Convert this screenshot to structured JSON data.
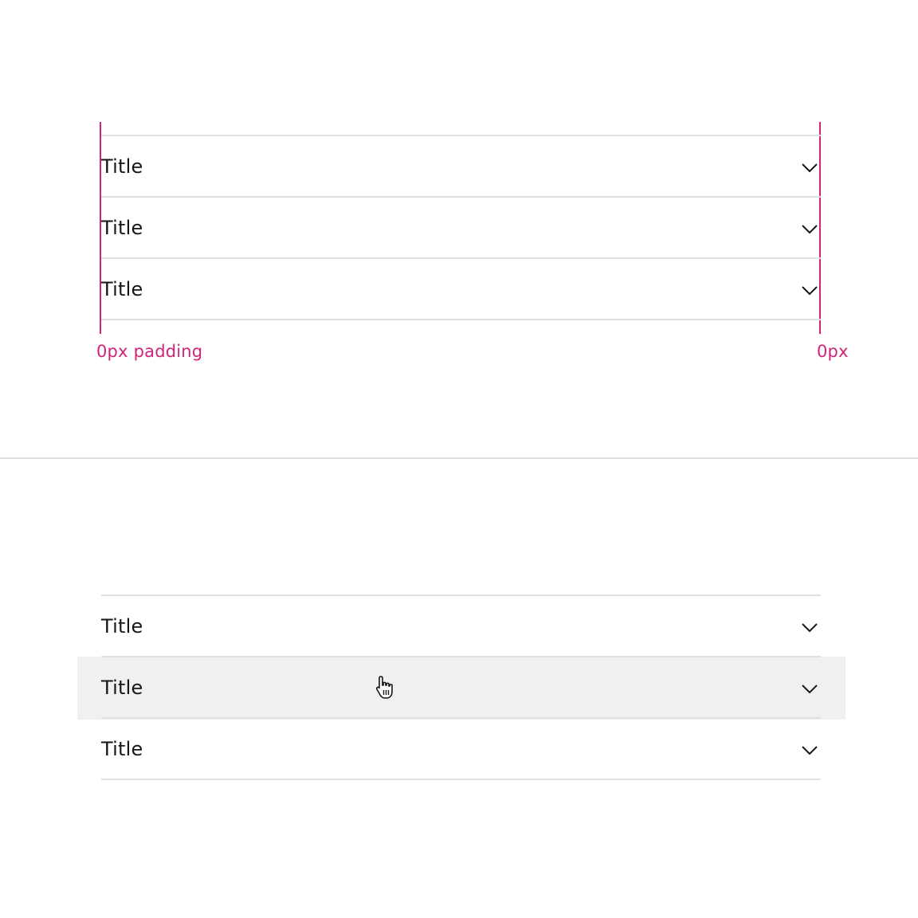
{
  "spec_example": {
    "items": [
      {
        "title": "Title"
      },
      {
        "title": "Title"
      },
      {
        "title": "Title"
      }
    ],
    "annotation_left": "0px padding",
    "annotation_right": "0px",
    "annotation_color": "#d0237a"
  },
  "hover_example": {
    "items": [
      {
        "title": "Title"
      },
      {
        "title": "Title"
      },
      {
        "title": "Title"
      }
    ],
    "hovered_index": 1,
    "hover_color": "#f0f0f0"
  },
  "icons": {
    "expand": "chevron-down-icon",
    "cursor": "hand-pointer-icon"
  }
}
